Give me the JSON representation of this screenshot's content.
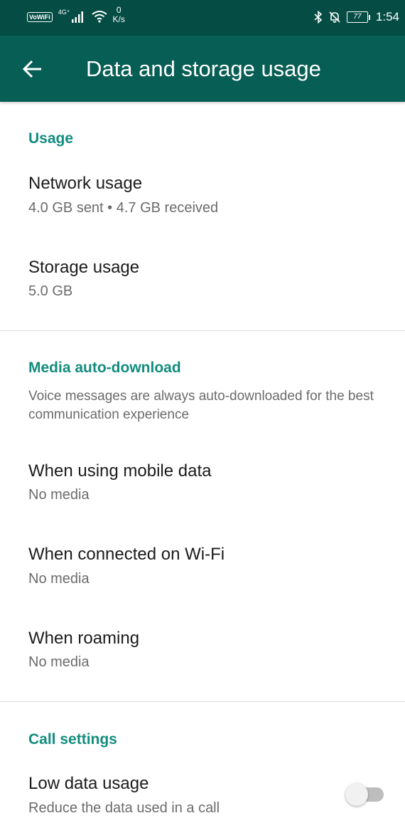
{
  "status_bar": {
    "vowifi": "VoWiFi",
    "network_type": "4G⁺",
    "speed_value": "0",
    "speed_unit": "K/s",
    "battery": "77",
    "time": "1:54",
    "icons": [
      "signal-icon",
      "wifi-icon",
      "bluetooth-icon",
      "bell-off-icon",
      "battery-icon"
    ]
  },
  "app_bar": {
    "title": "Data and storage usage",
    "back_icon": "arrow-left-icon"
  },
  "usage": {
    "header": "Usage",
    "network": {
      "title": "Network usage",
      "subtitle": "4.0 GB sent • 4.7 GB received"
    },
    "storage": {
      "title": "Storage usage",
      "subtitle": "5.0 GB"
    }
  },
  "media": {
    "header": "Media auto-download",
    "description": "Voice messages are always auto-downloaded for the best communication experience",
    "mobile": {
      "title": "When using mobile data",
      "subtitle": "No media"
    },
    "wifi": {
      "title": "When connected on Wi-Fi",
      "subtitle": "No media"
    },
    "roaming": {
      "title": "When roaming",
      "subtitle": "No media"
    }
  },
  "call": {
    "header": "Call settings",
    "low_data": {
      "title": "Low data usage",
      "subtitle": "Reduce the data used in a call",
      "enabled": false
    }
  },
  "colors": {
    "status_bar": "#054d44",
    "app_bar": "#075e54",
    "accent": "#128c7e"
  }
}
